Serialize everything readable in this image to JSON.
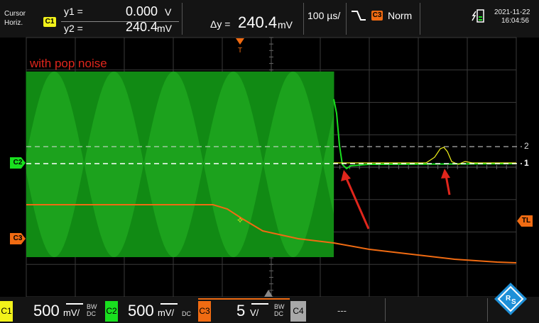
{
  "cursor_panel": {
    "title": "Cursor",
    "mode": "Horiz.",
    "source_channel": "C1",
    "y1_label": "y1 =",
    "y1_value": "0.000",
    "y1_unit": "V",
    "y2_label": "y2 =",
    "y2_value": "240.4",
    "y2_unit": "mV",
    "delta_label": "Δy =",
    "delta_value": "240.4",
    "delta_unit": "mV"
  },
  "timebase": "100 µs/",
  "trigger": {
    "source": "C3",
    "mode": "Norm",
    "marker": "T"
  },
  "datetime": {
    "date": "2021-11-22",
    "time": "16:04:56"
  },
  "annotation": "with pop noise",
  "markers": {
    "c2_level": "C2",
    "c3_level": "C3",
    "trigger_level": "TL",
    "cursor_line_1": "1",
    "cursor_line_2": "2"
  },
  "channels": [
    {
      "id": "C1",
      "scale": "500",
      "unit": "mV/",
      "bw": "BW",
      "coupling": "DC",
      "color": "#f2f21a"
    },
    {
      "id": "C2",
      "scale": "500",
      "unit": "mV/",
      "bw": "",
      "coupling": "DC",
      "color": "#19e01f"
    },
    {
      "id": "C3",
      "scale": "5",
      "unit": "V/",
      "bw": "BW",
      "coupling": "DC",
      "color": "#f06b12"
    },
    {
      "id": "C4",
      "scale": "---",
      "unit": "",
      "bw": "",
      "coupling": "",
      "color": "#a8a8a8"
    }
  ],
  "colors": {
    "c1_yellow": "#f2f21a",
    "c2_green": "#19e01f",
    "c3_orange": "#f06b12",
    "annotation_red": "#e0261c",
    "logo_blue": "#1e90d8"
  },
  "icons": [
    "trigger-falling-edge-icon",
    "usb-save-icon",
    "rs-logo-icon"
  ]
}
